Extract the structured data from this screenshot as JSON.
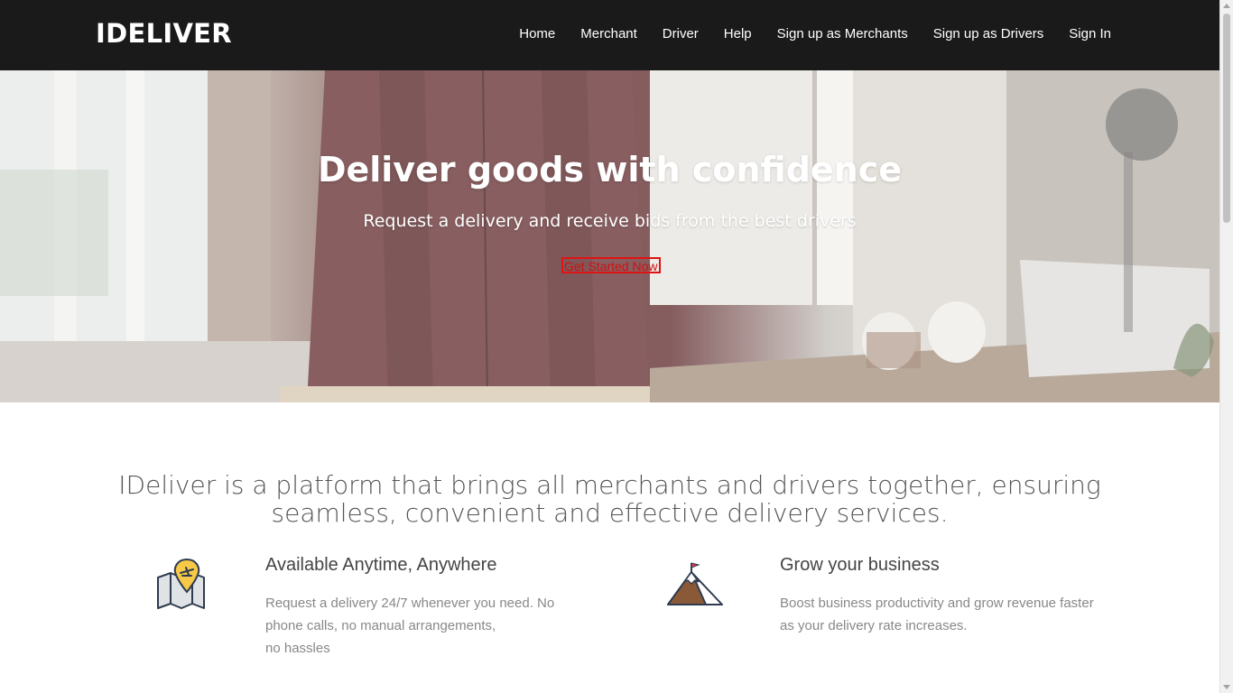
{
  "brand": "IDELIVER",
  "nav": [
    "Home",
    "Merchant",
    "Driver",
    "Help",
    "Sign up as Merchants",
    "Sign up as Drivers",
    "Sign In"
  ],
  "hero": {
    "title": "Deliver goods with confidence",
    "subtitle": "Request a delivery and receive bids from the best drivers",
    "cta": "Get Started Now"
  },
  "intro": "IDeliver is a platform that brings all merchants and drivers together, ensuring seamless, convenient and effective delivery services.",
  "features": [
    {
      "title": "Available Anytime, Anywhere",
      "description": [
        "Request a delivery 24/7 whenever you need. No",
        "phone calls, no manual arrangements,",
        "no hassles"
      ],
      "icon": "map-pin-icon"
    },
    {
      "title": "Grow your business",
      "description": [
        "Boost business productivity and grow revenue faster",
        "as your delivery rate increases."
      ],
      "icon": "mountain-flag-icon"
    }
  ],
  "colors": {
    "navbar": "#1a1a1a",
    "cta_border": "#e01212",
    "heading": "#444444",
    "body_text": "#888888",
    "intro_text": "#555555"
  }
}
